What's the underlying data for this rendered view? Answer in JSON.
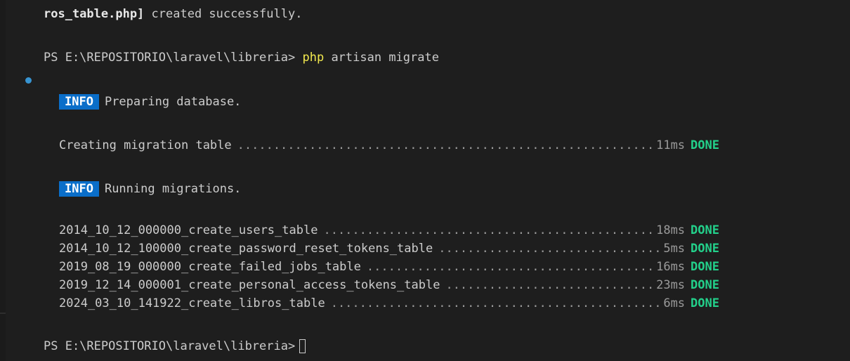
{
  "header_line": {
    "bold_part": "ros_table.php]",
    "rest": " created successfully."
  },
  "command_line": {
    "prompt": "PS E:\\REPOSITORIO\\laravel\\libreria>",
    "command_keyword": "php",
    "command_rest": " artisan migrate"
  },
  "info_prepare": {
    "badge": "INFO",
    "text": "Preparing database."
  },
  "create_table": {
    "label": "Creating migration table",
    "time": "11ms",
    "status": "DONE"
  },
  "info_running": {
    "badge": "INFO",
    "text": "Running migrations."
  },
  "migrations": [
    {
      "name": "2014_10_12_000000_create_users_table",
      "time": "18ms",
      "status": "DONE"
    },
    {
      "name": "2014_10_12_100000_create_password_reset_tokens_table",
      "time": "5ms",
      "status": "DONE"
    },
    {
      "name": "2019_08_19_000000_create_failed_jobs_table",
      "time": "16ms",
      "status": "DONE"
    },
    {
      "name": "2019_12_14_000001_create_personal_access_tokens_table",
      "time": "23ms",
      "status": "DONE"
    },
    {
      "name": "2024_03_10_141922_create_libros_table",
      "time": "6ms",
      "status": "DONE"
    }
  ],
  "final_prompt": {
    "prompt": "PS E:\\REPOSITORIO\\laravel\\libreria>"
  },
  "colors": {
    "background": "#1e1e1e",
    "text": "#cccccc",
    "php_keyword": "#f2e94e",
    "info_badge": "#0a6ec9",
    "done": "#23d18b",
    "status_dot": "#3794d1"
  }
}
